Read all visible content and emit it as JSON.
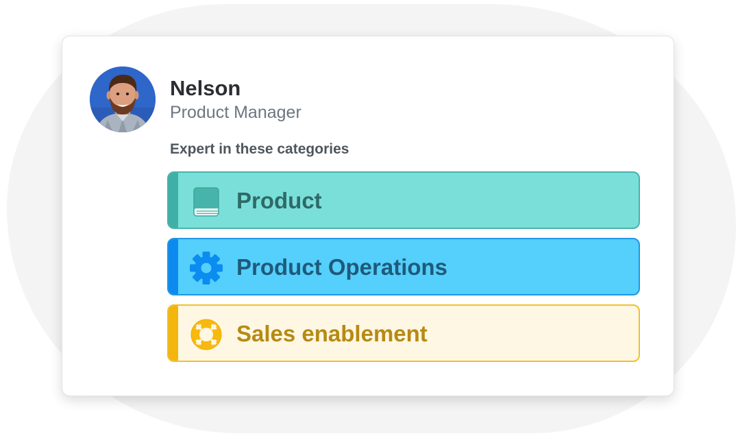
{
  "profile": {
    "name": "Nelson",
    "role": "Product Manager",
    "avatar_alt": "Nelson"
  },
  "expertise": {
    "heading": "Expert in these categories",
    "categories": [
      {
        "label": "Product",
        "icon": "book-icon",
        "accent": "#3fb0a6",
        "background": "#7adfd9",
        "text_color": "#2e6a68"
      },
      {
        "label": "Product Operations",
        "icon": "gear-icon",
        "accent": "#0d8af0",
        "background": "#55cffb",
        "text_color": "#1e5a7a"
      },
      {
        "label": "Sales enablement",
        "icon": "lifebuoy-icon",
        "accent": "#f4b50c",
        "background": "#fef7e3",
        "text_color": "#b68a13"
      }
    ]
  }
}
